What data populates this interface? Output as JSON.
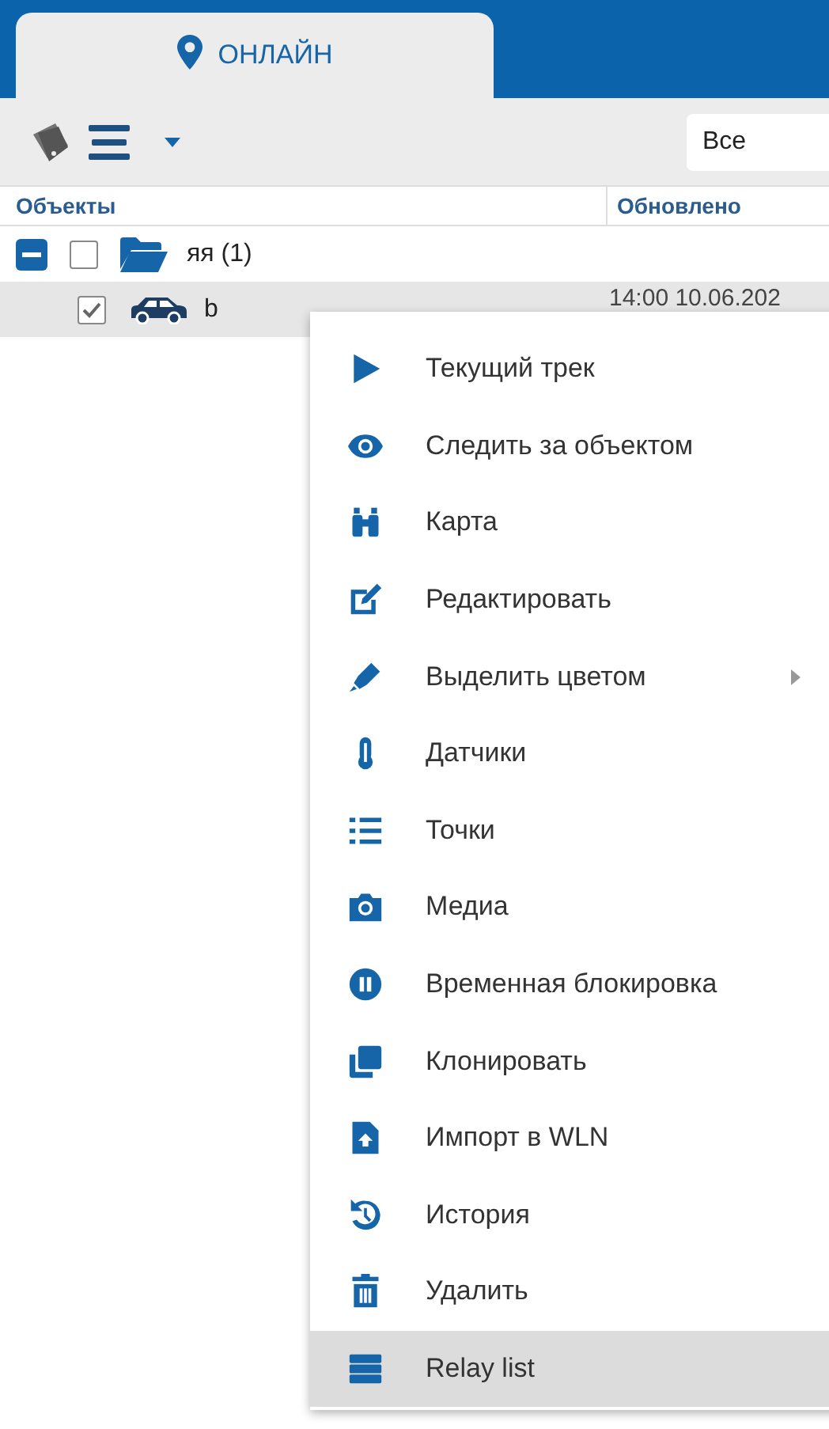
{
  "tab": {
    "label": "ОНЛАЙН",
    "selected": true
  },
  "filter": {
    "value": "Все"
  },
  "columns": [
    "Объекты",
    "Обновлено"
  ],
  "tree": [
    {
      "label": "яя (1)",
      "expanded": true,
      "checked": false,
      "children": [
        {
          "label": "b",
          "checked": true,
          "selected": true,
          "updated": "14:00 10.06.202"
        }
      ]
    }
  ],
  "context_menu": {
    "items": [
      {
        "label": "Текущий трек",
        "selected": false
      },
      {
        "label": "Следить за объектом",
        "selected": false
      },
      {
        "label": "Карта",
        "selected": false
      },
      {
        "label": "Редактировать",
        "selected": false
      },
      {
        "label": "Выделить цветом",
        "selected": false,
        "has_submenu": true
      },
      {
        "label": "Датчики",
        "selected": false
      },
      {
        "label": "Точки",
        "selected": false
      },
      {
        "label": "Медиа",
        "selected": false
      },
      {
        "label": "Временная блокировка",
        "selected": false
      },
      {
        "label": "Клонировать",
        "selected": false
      },
      {
        "label": "Импорт в WLN",
        "selected": false
      },
      {
        "label": "История",
        "selected": false
      },
      {
        "label": "Удалить",
        "selected": false
      },
      {
        "label": "Relay list",
        "selected": true
      }
    ]
  }
}
